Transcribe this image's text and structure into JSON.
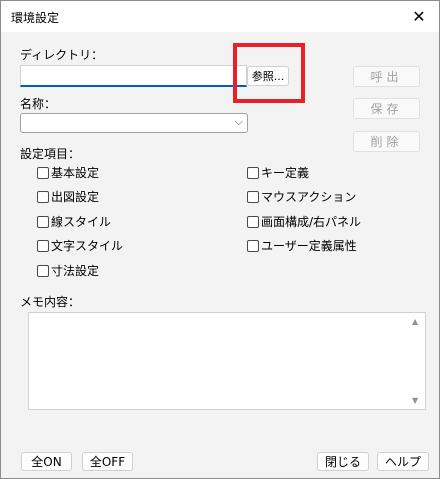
{
  "window": {
    "title": "環境設定",
    "close_glyph": "✕"
  },
  "directory": {
    "label": "ディレクトリ：",
    "value": "",
    "browse_label": "参照..."
  },
  "side_buttons": {
    "recall": "呼出",
    "save": "保存",
    "delete": "削除"
  },
  "name": {
    "label": "名称：",
    "selected": "",
    "arrow": "⌵"
  },
  "settings": {
    "label": "設定項目：",
    "items": [
      {
        "label": "基本設定",
        "checked": false
      },
      {
        "label": "出図設定",
        "checked": false
      },
      {
        "label": "線スタイル",
        "checked": false
      },
      {
        "label": "文字スタイル",
        "checked": false
      },
      {
        "label": "寸法設定",
        "checked": false
      },
      {
        "label": "キー定義",
        "checked": false
      },
      {
        "label": "マウスアクション",
        "checked": false
      },
      {
        "label": "画面構成/右パネル",
        "checked": false
      },
      {
        "label": "ユーザー定義属性",
        "checked": false
      }
    ]
  },
  "memo": {
    "label": "メモ内容：",
    "value": "",
    "scroll_up": "▲",
    "scroll_down": "▼"
  },
  "footer": {
    "all_on": "全ON",
    "all_off": "全OFF",
    "close": "閉じる",
    "help": "ヘルプ"
  },
  "colors": {
    "highlight": "#e8202a",
    "focus_underline": "#005fb8"
  }
}
